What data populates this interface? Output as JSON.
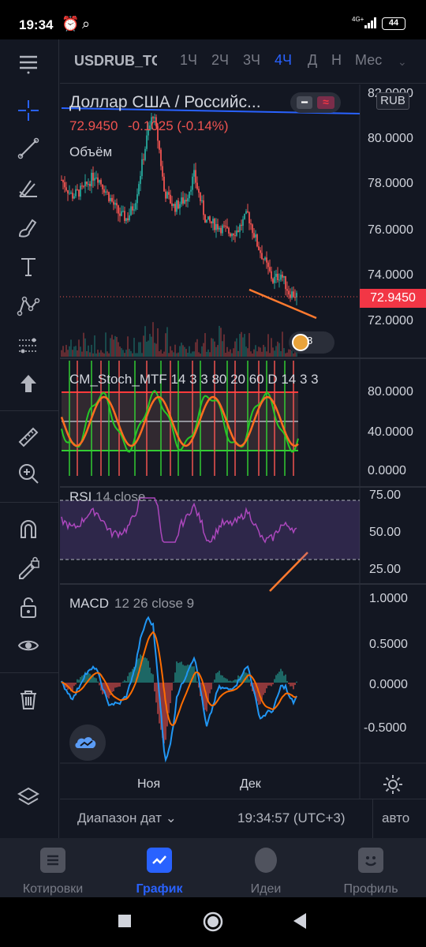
{
  "status_bar": {
    "time": "19:34",
    "network": "4G+",
    "battery": "44"
  },
  "header": {
    "symbol": "USDRUB_TC",
    "timeframes": [
      {
        "label": "1Ч",
        "active": false
      },
      {
        "label": "2Ч",
        "active": false
      },
      {
        "label": "3Ч",
        "active": false
      },
      {
        "label": "4Ч",
        "active": true
      },
      {
        "label": "Д",
        "active": false
      },
      {
        "label": "Н",
        "active": false
      },
      {
        "label": "Мес",
        "active": false
      }
    ]
  },
  "main_pane": {
    "title": "Доллар США / Российс...",
    "last_price": "72.9450",
    "change": "-0.1025 (-0.14%)",
    "volume_label": "Объём",
    "currency_badge": "RUB",
    "events_count": "8",
    "axis_ticks": [
      "82.0000",
      "80.0000",
      "78.0000",
      "76.0000",
      "74.0000",
      "72.0000"
    ]
  },
  "stoch_pane": {
    "label": "CM_Stoch_MTF 14 3 3 80 20 60 D 14 3 3",
    "axis_ticks": [
      "80.0000",
      "40.0000",
      "0.0000"
    ]
  },
  "rsi_pane": {
    "name": "RSI",
    "params": "14 close",
    "axis_ticks": [
      "75.00",
      "50.00",
      "25.00"
    ]
  },
  "macd_pane": {
    "name": "MACD",
    "params": "12 26 close 9",
    "axis_ticks": [
      "1.0000",
      "0.5000",
      "0.0000",
      "-0.5000"
    ]
  },
  "time_axis": {
    "labels": [
      "Ноя",
      "Дек"
    ]
  },
  "range_bar": {
    "range_label": "Диапазон дат",
    "clock": "19:34:57 (UTC+3)",
    "scale_mode": "авто"
  },
  "bottom_nav": [
    {
      "label": "Котировки",
      "icon": "list-icon",
      "active": false
    },
    {
      "label": "График",
      "icon": "chart-icon",
      "active": true
    },
    {
      "label": "Идеи",
      "icon": "lightbulb-icon",
      "active": false
    },
    {
      "label": "Профиль",
      "icon": "smiley-icon",
      "active": false
    }
  ],
  "colors": {
    "background": "#131722",
    "accent": "#2962ff",
    "up": "#26a69a",
    "down": "#ef5350",
    "price_tag": "#f23645",
    "annotation": "#ff7a2f"
  }
}
